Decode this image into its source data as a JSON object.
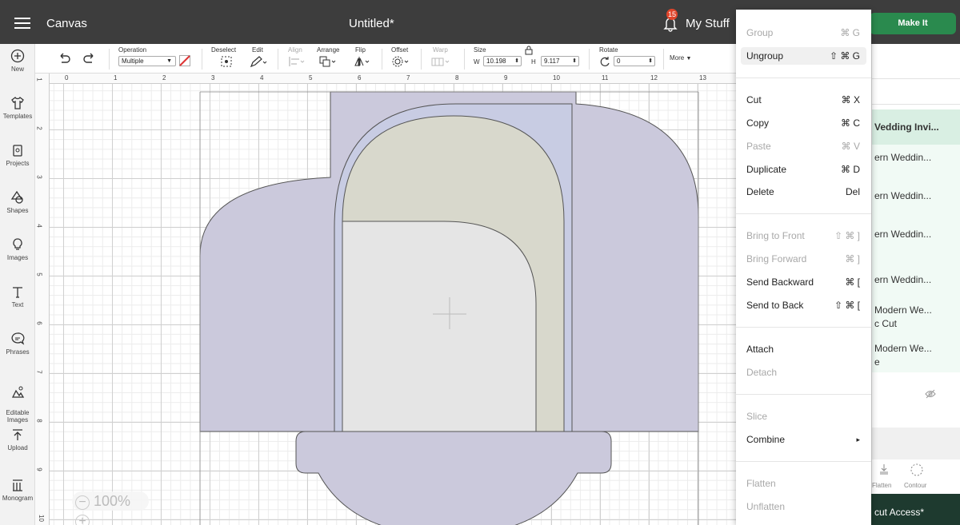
{
  "app": {
    "name": "Canvas",
    "doc_title": "Untitled*",
    "notifications": "15",
    "my_stuff": "My Stuff",
    "make_it": "Make It"
  },
  "sidebar": {
    "items": [
      {
        "label": "New",
        "icon": "plus-circle-icon"
      },
      {
        "label": "Templates",
        "icon": "shirt-icon"
      },
      {
        "label": "Projects",
        "icon": "projects-icon"
      },
      {
        "label": "Shapes",
        "icon": "shapes-icon"
      },
      {
        "label": "Images",
        "icon": "lightbulb-icon"
      },
      {
        "label": "Text",
        "icon": "text-icon"
      },
      {
        "label": "Phrases",
        "icon": "speech-bubble-icon"
      },
      {
        "label": "Editable\nImages",
        "icon": "editable-images-icon"
      },
      {
        "label": "Upload",
        "icon": "upload-icon"
      },
      {
        "label": "Monogram",
        "icon": "monogram-icon"
      }
    ]
  },
  "toolbar": {
    "operation_label": "Operation",
    "operation_value": "Multiple",
    "deselect": "Deselect",
    "edit": "Edit",
    "align": "Align",
    "arrange": "Arrange",
    "flip": "Flip",
    "offset": "Offset",
    "warp": "Warp",
    "size": "Size",
    "w_label": "W",
    "w_value": "10.198",
    "h_label": "H",
    "h_value": "9.117",
    "rotate": "Rotate",
    "rotate_value": "0",
    "more": "More"
  },
  "ruler": {
    "top": [
      "0",
      "1",
      "2",
      "3",
      "4",
      "5",
      "6",
      "7",
      "8",
      "9",
      "10",
      "11",
      "12",
      "13"
    ],
    "left": [
      "1",
      "2",
      "3",
      "4",
      "5",
      "6",
      "7",
      "8",
      "9",
      "10"
    ]
  },
  "zoom": {
    "value": "100%",
    "minus": "−",
    "plus": "+"
  },
  "context_menu": {
    "items": [
      {
        "label": "Group",
        "shortcut": "⌘ G",
        "disabled": true
      },
      {
        "label": "Ungroup",
        "shortcut": "⇧ ⌘ G",
        "disabled": false,
        "highlight": true
      },
      {
        "label": "Cut",
        "shortcut": "⌘ X",
        "disabled": false
      },
      {
        "label": "Copy",
        "shortcut": "⌘ C",
        "disabled": false
      },
      {
        "label": "Paste",
        "shortcut": "⌘ V",
        "disabled": true
      },
      {
        "label": "Duplicate",
        "shortcut": "⌘ D",
        "disabled": false
      },
      {
        "label": "Delete",
        "shortcut": "Del",
        "disabled": false
      },
      {
        "label": "Bring to Front",
        "shortcut": "⇧ ⌘ ]",
        "disabled": true
      },
      {
        "label": "Bring Forward",
        "shortcut": "⌘ ]",
        "disabled": true
      },
      {
        "label": "Send Backward",
        "shortcut": "⌘ [",
        "disabled": false
      },
      {
        "label": "Send to Back",
        "shortcut": "⇧ ⌘ [",
        "disabled": false
      },
      {
        "label": "Attach",
        "shortcut": "",
        "disabled": false
      },
      {
        "label": "Detach",
        "shortcut": "",
        "disabled": true
      },
      {
        "label": "Slice",
        "shortcut": "",
        "disabled": true
      },
      {
        "label": "Combine",
        "shortcut": "▸",
        "disabled": false
      },
      {
        "label": "Flatten",
        "shortcut": "",
        "disabled": true
      },
      {
        "label": "Unflatten",
        "shortcut": "",
        "disabled": true
      }
    ]
  },
  "layers": {
    "items": [
      "Vedding Invi...",
      "ern Weddin...",
      "ern Weddin...",
      "ern Weddin...",
      "ern Weddin...",
      "Modern We...",
      "c Cut",
      "Modern We...",
      "e"
    ],
    "flatten": "Flatten",
    "contour": "Contour",
    "access": "cut Access*"
  },
  "colors": {
    "topbar": "#3d3d3d",
    "accent": "#2a8a4e",
    "envelope": "#cbc9dc",
    "card": "#d8d8cc",
    "insert": "#e5e5e5",
    "liner": "#c8cce3"
  }
}
